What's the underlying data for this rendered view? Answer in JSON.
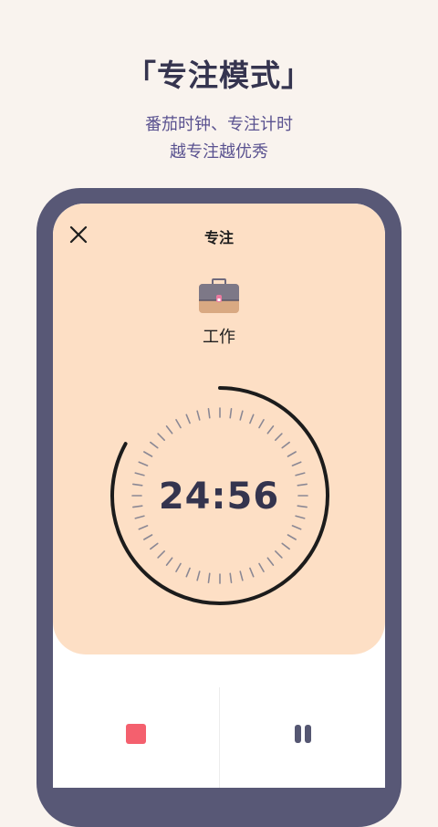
{
  "promo": {
    "title": "「专注模式」",
    "subtitle_line1": "番茄时钟、专注计时",
    "subtitle_line2": "越专注越优秀"
  },
  "screen": {
    "title": "专注",
    "category": {
      "label": "工作",
      "icon": "briefcase-icon"
    },
    "timer": {
      "display": "24:56",
      "progress_fraction": 0.83
    },
    "controls": {
      "stop_icon": "stop-icon",
      "pause_icon": "pause-icon"
    },
    "close_icon": "close-icon"
  },
  "colors": {
    "page_background": "#f9f3ee",
    "headline": "#35344f",
    "subtitle": "#5a5290",
    "phone_frame": "#585876",
    "focus_card": "#fddfc5",
    "stop_button": "#f4606e",
    "pause_button": "#555772"
  }
}
